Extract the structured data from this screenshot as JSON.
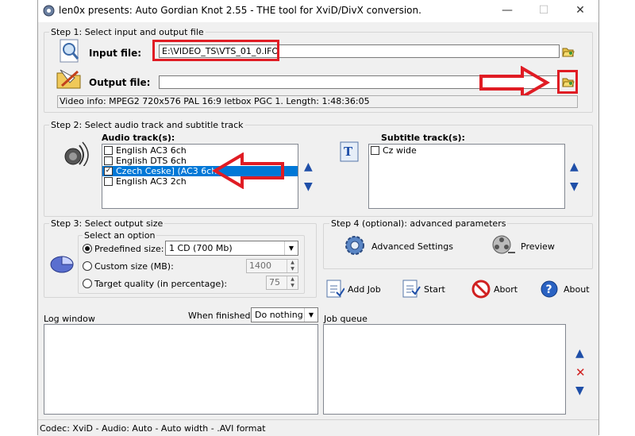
{
  "window": {
    "title": "len0x presents: Auto Gordian Knot 2.55 - THE tool for XviD/DivX conversion.",
    "controls": {
      "minimize": "—",
      "maximize": "☐",
      "close": "✕"
    }
  },
  "step1": {
    "label": "Step 1: Select input and output file",
    "input_label": "Input file:",
    "input_value": "E:\\VIDEO_TS\\VTS_01_0.IFO",
    "output_label": "Output file:",
    "output_value": "",
    "video_info": "Video info: MPEG2 720x576 PAL 16:9 letbox  PGC 1. Length: 1:48:36:05"
  },
  "step2": {
    "label": "Step 2: Select audio track and subtitle track",
    "audio_label": "Audio track(s):",
    "audio_tracks": [
      {
        "label": "English AC3 6ch",
        "checked": false,
        "selected": false
      },
      {
        "label": "English DTS 6ch",
        "checked": false,
        "selected": false
      },
      {
        "label": "Czech Ceske] (AC3 6ch",
        "checked": true,
        "selected": true
      },
      {
        "label": "English AC3 2ch",
        "checked": false,
        "selected": false
      }
    ],
    "subtitle_label": "Subtitle track(s):",
    "subtitle_tracks": [
      {
        "label": "Cz wide",
        "checked": false
      }
    ]
  },
  "step3": {
    "label": "Step 3: Select output size",
    "option_label": "Select an option",
    "predefined_label": "Predefined size:",
    "predefined_value": "1 CD (700 Mb)",
    "custom_label": "Custom size (MB):",
    "custom_value": "1400",
    "quality_label": "Target quality (in percentage):",
    "quality_value": "75",
    "selected_option": "predefined"
  },
  "step4": {
    "label": "Step 4 (optional): advanced parameters",
    "advanced_label": "Advanced Settings",
    "preview_label": "Preview"
  },
  "actions": {
    "add_job": "Add Job",
    "start": "Start",
    "abort": "Abort",
    "about": "About"
  },
  "log": {
    "label": "Log window",
    "when_finished_label": "When finished:",
    "when_finished_value": "Do nothing"
  },
  "queue": {
    "label": "Job queue"
  },
  "status": "Codec: XviD -  Audio: Auto -  Auto width - .AVI format",
  "colors": {
    "highlight": "#0078d7",
    "annotation_red": "#e01c24",
    "arrow_blue": "#1f4fa8"
  }
}
